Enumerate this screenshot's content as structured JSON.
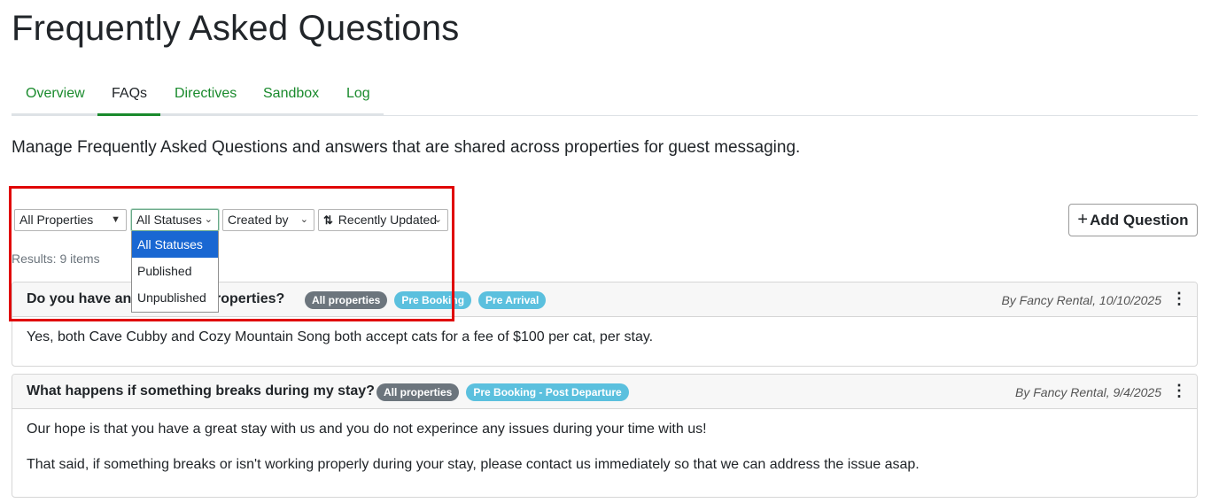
{
  "page": {
    "title": "Frequently Asked Questions",
    "description": "Manage Frequently Asked Questions and answers that are shared across properties for guest messaging."
  },
  "tabs": [
    {
      "label": "Overview",
      "active": false
    },
    {
      "label": "FAQs",
      "active": true
    },
    {
      "label": "Directives",
      "active": false
    },
    {
      "label": "Sandbox",
      "active": false
    },
    {
      "label": "Log",
      "active": false
    }
  ],
  "filters": {
    "properties": {
      "value": "All Properties",
      "icon": "caret-down-icon"
    },
    "status": {
      "value": "All Statuses",
      "icon": "chevron-down-icon",
      "expanded": true,
      "options": [
        "All Statuses",
        "Published",
        "Unpublished"
      ],
      "selected_index": 0
    },
    "created_by": {
      "value": "Created by",
      "icon": "chevron-down-icon"
    },
    "sort": {
      "value": "Recently Updated",
      "icon": "sort-arrows-icon"
    }
  },
  "add_button": {
    "label": "Add Question",
    "icon": "plus-icon"
  },
  "results_text": "Results: 9 items",
  "faqs": [
    {
      "question": "Do you have any pet-friendly properties?",
      "question_visible_start": "Do you have an",
      "question_visible_end": "properties?",
      "badges": [
        {
          "label": "All properties",
          "color": "#6c757d"
        },
        {
          "label": "Pre Booking",
          "color": "#5bc0de"
        },
        {
          "label": "Pre Arrival",
          "color": "#5bc0de"
        }
      ],
      "byline": "By Fancy Rental, 10/10/2025",
      "answer": [
        "Yes, both Cave Cubby and Cozy Mountain Song both accept cats for a fee of $100 per cat, per stay."
      ]
    },
    {
      "question": "What happens if something breaks during my stay?",
      "badges": [
        {
          "label": "All properties",
          "color": "#6c757d"
        },
        {
          "label": "Pre Booking - Post Departure",
          "color": "#5bc0de"
        }
      ],
      "byline": "By Fancy Rental, 9/4/2025",
      "answer": [
        "Our hope is that you have a great stay with us and you do not experince any issues during your time with us!",
        "That said, if something breaks or isn't working properly during your stay, please contact us immediately so that we can address the issue asap."
      ]
    }
  ],
  "colors": {
    "accent": "#198a2c",
    "highlight": "#e00000",
    "selected_option": "#1967d2"
  }
}
